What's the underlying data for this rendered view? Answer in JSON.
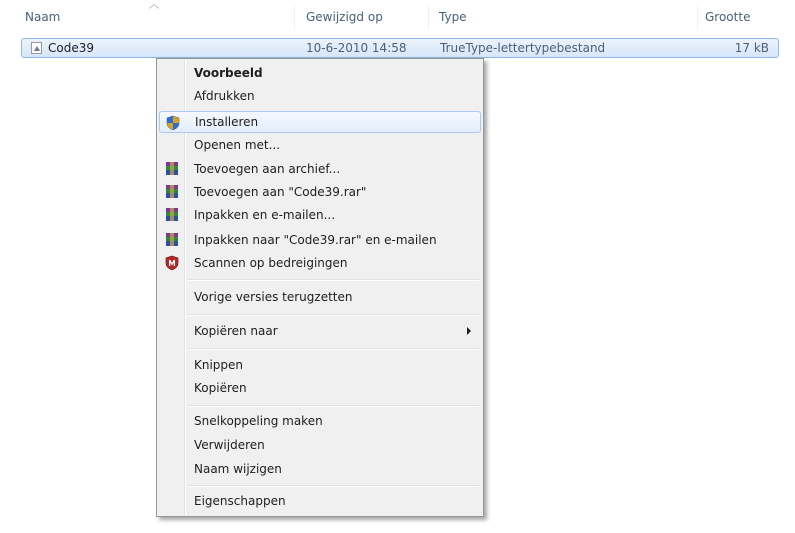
{
  "columns": {
    "name": "Naam",
    "modified": "Gewijzigd op",
    "type": "Type",
    "size": "Grootte"
  },
  "file": {
    "name": "Code39",
    "modified": "10-6-2010 14:58",
    "type": "TrueType-lettertypebestand",
    "size": "17 kB"
  },
  "context_menu": {
    "items": [
      {
        "label": "Voorbeeld",
        "bold": true
      },
      {
        "label": "Afdrukken"
      },
      {
        "label": "Installeren",
        "icon": "uac-shield-icon",
        "highlighted": true
      },
      {
        "label": "Openen met..."
      },
      {
        "label": "Toevoegen aan archief...",
        "icon": "winrar-icon"
      },
      {
        "label": "Toevoegen aan \"Code39.rar\"",
        "icon": "winrar-icon"
      },
      {
        "label": "Inpakken en e-mailen...",
        "icon": "winrar-icon"
      },
      {
        "label": "Inpakken naar \"Code39.rar\" en e-mailen",
        "icon": "winrar-icon"
      },
      {
        "label": "Scannen op bedreigingen",
        "icon": "antivirus-shield-icon"
      },
      {
        "label": "Vorige versies terugzetten"
      },
      {
        "label": "Kopiëren naar",
        "submenu": true
      },
      {
        "label": "Knippen"
      },
      {
        "label": "Kopiëren"
      },
      {
        "label": "Snelkoppeling maken"
      },
      {
        "label": "Verwijderen"
      },
      {
        "label": "Naam wijzigen"
      },
      {
        "label": "Eigenschappen"
      }
    ]
  },
  "colors": {
    "selection_border": "#8fb6e6",
    "menu_background": "#f0f0f0",
    "header_text": "#4c607a"
  }
}
